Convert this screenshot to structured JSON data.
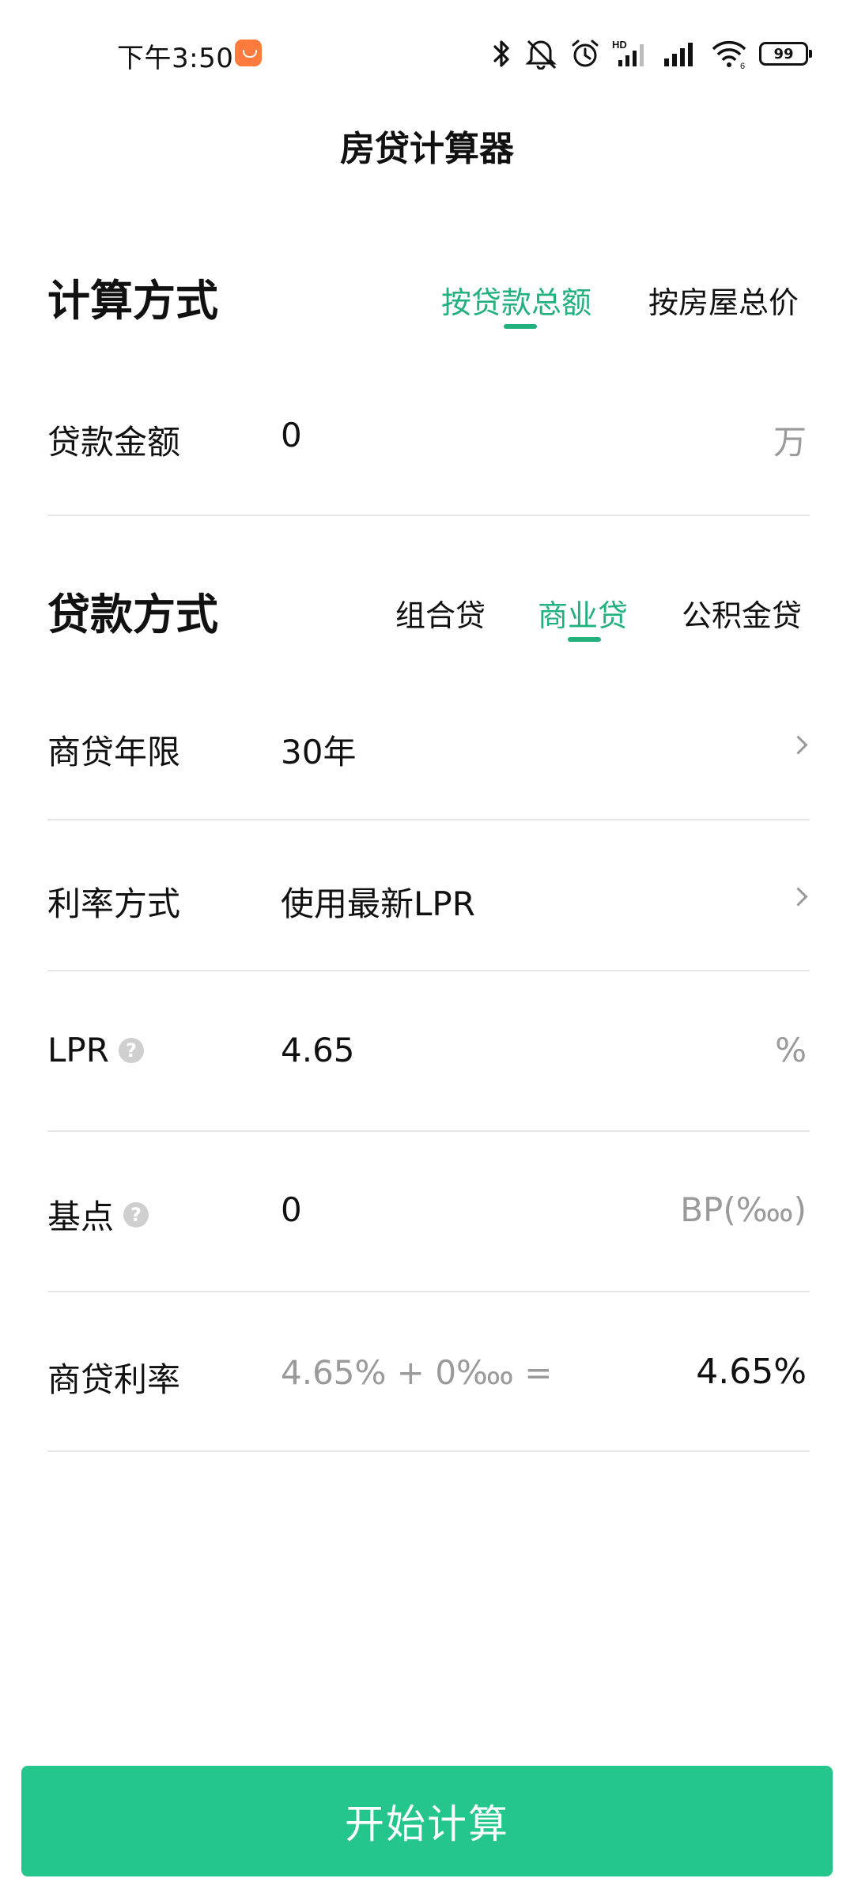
{
  "status_bar": {
    "time": "下午3:50",
    "battery_level": "99",
    "icons": [
      "bluetooth-icon",
      "mute-icon",
      "alarm-icon",
      "hd-signal-icon",
      "signal-icon",
      "wifi-icon",
      "battery-icon"
    ],
    "network_hd_label": "HD",
    "wifi_sub_label": "6"
  },
  "header": {
    "title": "房贷计算器"
  },
  "calc_method": {
    "title": "计算方式",
    "tabs": [
      {
        "label": "按贷款总额",
        "active": true
      },
      {
        "label": "按房屋总价",
        "active": false
      }
    ]
  },
  "loan_amount": {
    "label": "贷款金额",
    "value": "0",
    "unit": "万"
  },
  "loan_type": {
    "title": "贷款方式",
    "tabs": [
      {
        "label": "组合贷",
        "active": false
      },
      {
        "label": "商业贷",
        "active": true
      },
      {
        "label": "公积金贷",
        "active": false
      }
    ]
  },
  "rows": {
    "term": {
      "label": "商贷年限",
      "value": "30年"
    },
    "rate_method": {
      "label": "利率方式",
      "value": "使用最新LPR"
    },
    "lpr": {
      "label": "LPR",
      "value": "4.65",
      "unit": "%"
    },
    "basis_point": {
      "label": "基点",
      "value": "0",
      "unit": "BP(‱)"
    },
    "commercial_rate": {
      "label": "商贷利率",
      "formula": "4.65% + 0‱ =",
      "result": "4.65%"
    }
  },
  "actions": {
    "start_label": "开始计算"
  },
  "colors": {
    "accent": "#22b07d",
    "button": "#24c68c",
    "muted_text": "#9a9a9a",
    "divider": "#e6e6e6"
  }
}
